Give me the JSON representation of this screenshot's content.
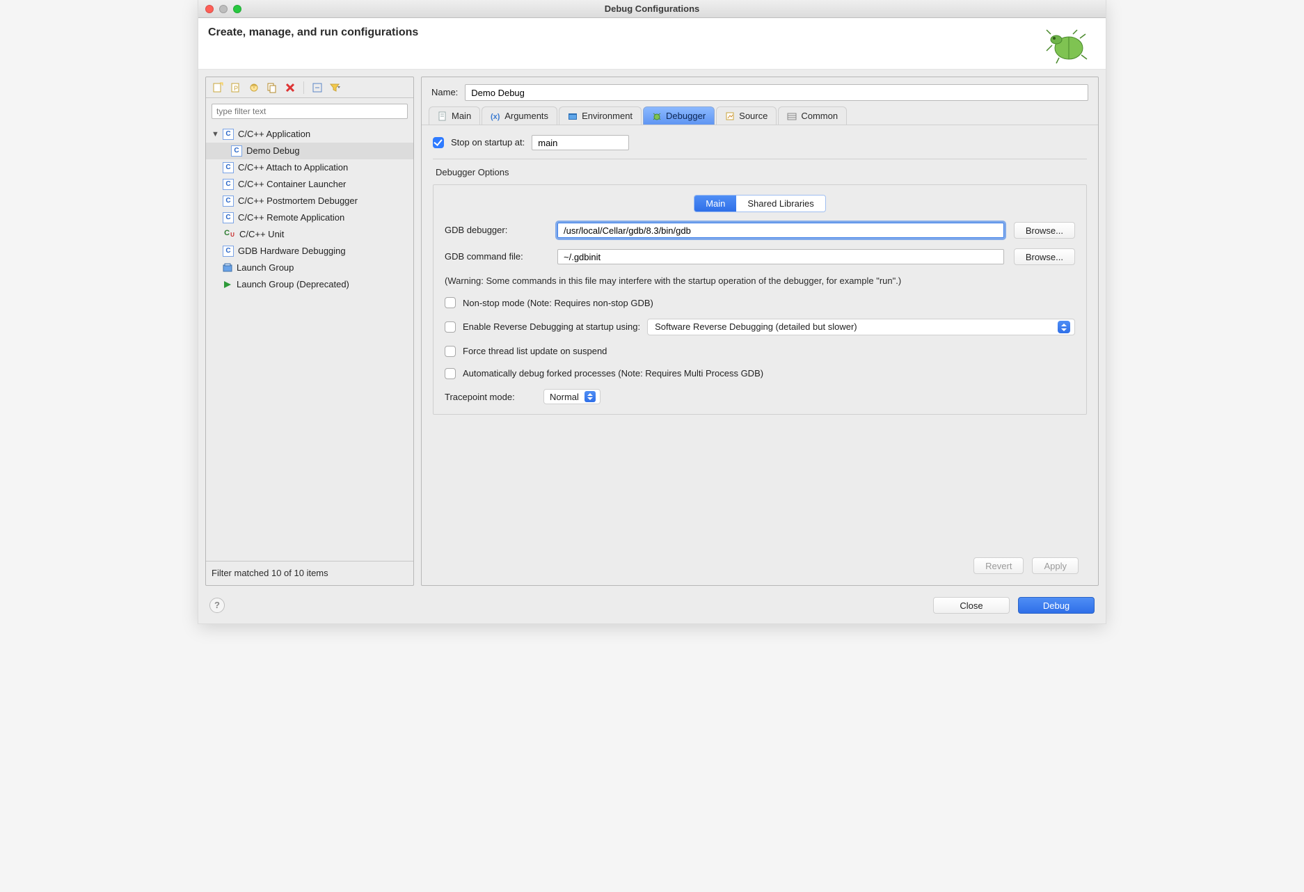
{
  "window": {
    "title": "Debug Configurations"
  },
  "header": {
    "title": "Create, manage, and run configurations"
  },
  "sidebar": {
    "filter_placeholder": "type filter text",
    "items": [
      {
        "label": "C/C++ Application",
        "icon": "c",
        "expanded": true,
        "children": [
          {
            "label": "Demo Debug",
            "icon": "c",
            "selected": true
          }
        ]
      },
      {
        "label": "C/C++ Attach to Application",
        "icon": "c"
      },
      {
        "label": "C/C++ Container Launcher",
        "icon": "c"
      },
      {
        "label": "C/C++ Postmortem Debugger",
        "icon": "c"
      },
      {
        "label": "C/C++ Remote Application",
        "icon": "c"
      },
      {
        "label": "C/C++ Unit",
        "icon": "cu"
      },
      {
        "label": "GDB Hardware Debugging",
        "icon": "c"
      },
      {
        "label": "Launch Group",
        "icon": "launch-group"
      },
      {
        "label": "Launch Group (Deprecated)",
        "icon": "play"
      }
    ],
    "footer": "Filter matched 10 of 10 items"
  },
  "form": {
    "name_label": "Name:",
    "name_value": "Demo Debug",
    "tabs": [
      {
        "id": "main",
        "label": "Main"
      },
      {
        "id": "arguments",
        "label": "Arguments"
      },
      {
        "id": "environment",
        "label": "Environment"
      },
      {
        "id": "debugger",
        "label": "Debugger",
        "active": true
      },
      {
        "id": "source",
        "label": "Source"
      },
      {
        "id": "common",
        "label": "Common"
      }
    ],
    "stop_on_startup": {
      "label": "Stop on startup at:",
      "checked": true,
      "value": "main"
    },
    "debugger_options_title": "Debugger Options",
    "segmented": {
      "options": [
        "Main",
        "Shared Libraries"
      ],
      "active": 0
    },
    "gdb_debugger": {
      "label": "GDB debugger:",
      "value": "/usr/local/Cellar/gdb/8.3/bin/gdb",
      "browse": "Browse..."
    },
    "gdb_command_file": {
      "label": "GDB command file:",
      "value": "~/.gdbinit",
      "browse": "Browse..."
    },
    "warning": "(Warning: Some commands in this file may interfere with the startup operation of the debugger, for example \"run\".)",
    "checks": {
      "non_stop": {
        "label": "Non-stop mode (Note: Requires non-stop GDB)",
        "checked": false
      },
      "reverse": {
        "label": "Enable Reverse Debugging at startup using:",
        "checked": false,
        "select_value": "Software Reverse Debugging (detailed but slower)"
      },
      "force_update": {
        "label": "Force thread list update on suspend",
        "checked": false
      },
      "auto_fork": {
        "label": "Automatically debug forked processes (Note: Requires Multi Process GDB)",
        "checked": false
      }
    },
    "tracepoint": {
      "label": "Tracepoint mode:",
      "value": "Normal"
    },
    "revert": "Revert",
    "apply": "Apply"
  },
  "bottom": {
    "close": "Close",
    "debug": "Debug"
  }
}
